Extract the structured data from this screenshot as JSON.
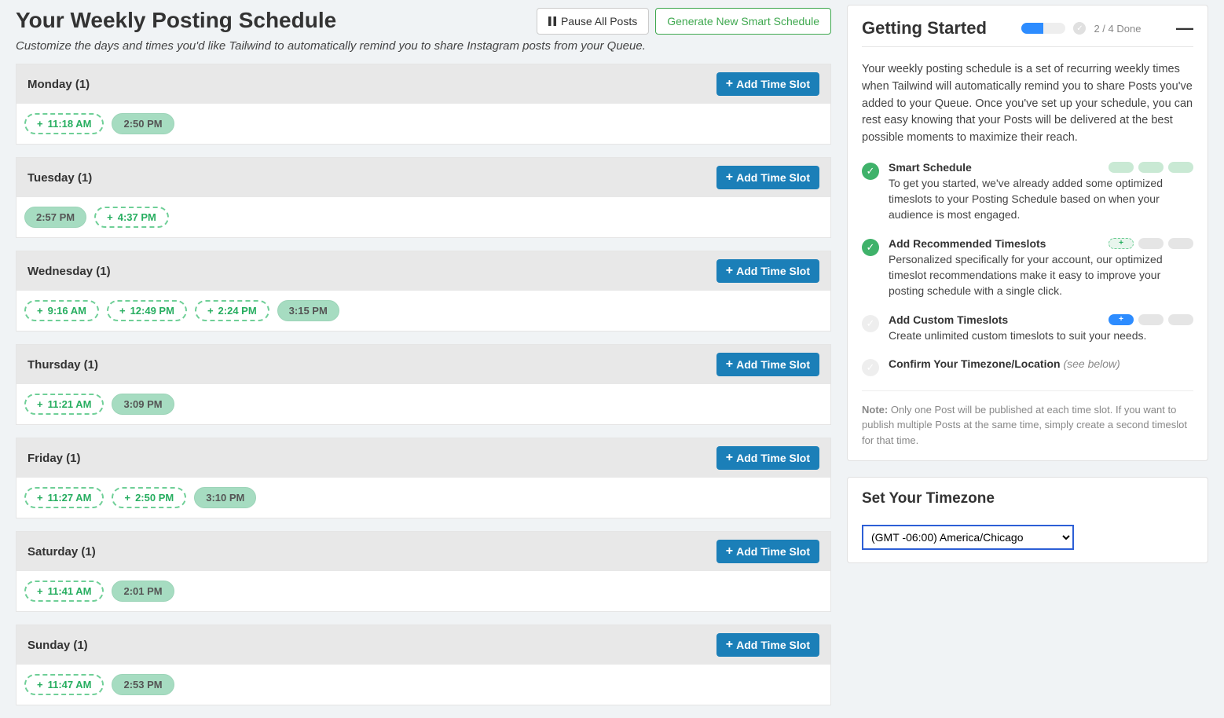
{
  "header": {
    "title": "Your Weekly Posting Schedule",
    "subtitle": "Customize the days and times you'd like Tailwind to automatically remind you to share Instagram posts from your Queue.",
    "pause_label": "Pause All Posts",
    "generate_label": "Generate New Smart Schedule"
  },
  "add_slot_label": "Add Time Slot",
  "days": [
    {
      "name": "Monday (1)",
      "slots": [
        {
          "time": "11:18 AM",
          "type": "suggested"
        },
        {
          "time": "2:50 PM",
          "type": "active"
        }
      ]
    },
    {
      "name": "Tuesday (1)",
      "slots": [
        {
          "time": "2:57 PM",
          "type": "active"
        },
        {
          "time": "4:37 PM",
          "type": "suggested"
        }
      ]
    },
    {
      "name": "Wednesday (1)",
      "slots": [
        {
          "time": "9:16 AM",
          "type": "suggested"
        },
        {
          "time": "12:49 PM",
          "type": "suggested"
        },
        {
          "time": "2:24 PM",
          "type": "suggested"
        },
        {
          "time": "3:15 PM",
          "type": "active"
        }
      ]
    },
    {
      "name": "Thursday (1)",
      "slots": [
        {
          "time": "11:21 AM",
          "type": "suggested"
        },
        {
          "time": "3:09 PM",
          "type": "active"
        }
      ]
    },
    {
      "name": "Friday (1)",
      "slots": [
        {
          "time": "11:27 AM",
          "type": "suggested"
        },
        {
          "time": "2:50 PM",
          "type": "suggested"
        },
        {
          "time": "3:10 PM",
          "type": "active"
        }
      ]
    },
    {
      "name": "Saturday (1)",
      "slots": [
        {
          "time": "11:41 AM",
          "type": "suggested"
        },
        {
          "time": "2:01 PM",
          "type": "active"
        }
      ]
    },
    {
      "name": "Sunday (1)",
      "slots": [
        {
          "time": "11:47 AM",
          "type": "suggested"
        },
        {
          "time": "2:53 PM",
          "type": "active"
        }
      ]
    }
  ],
  "getting_started": {
    "title": "Getting Started",
    "progress_percent": 50,
    "done_text": "2 / 4 Done",
    "description": "Your weekly posting schedule is a set of recurring weekly times when Tailwind will automatically remind you to share Posts you've added to your Queue. Once you've set up your schedule, you can rest easy knowing that your Posts will be delivered at the best possible moments to maximize their reach.",
    "items": [
      {
        "done": true,
        "title": "Smart Schedule",
        "desc": "To get you started, we've already added some optimized timeslots to your Posting Schedule based on when your audience is most engaged.",
        "pills": [
          "green",
          "green",
          "green"
        ]
      },
      {
        "done": true,
        "title": "Add Recommended Timeslots",
        "desc": "Personalized specifically for your account, our optimized timeslot recommendations make it easy to improve your posting schedule with a single click.",
        "pills": [
          "greenplus",
          "grey",
          "grey"
        ]
      },
      {
        "done": false,
        "title": "Add Custom Timeslots",
        "desc": "Create unlimited custom timeslots to suit your needs.",
        "pills": [
          "blue",
          "grey",
          "grey"
        ]
      },
      {
        "done": false,
        "title": "Confirm Your Timezone/Location",
        "see_below": "(see below)",
        "desc": "",
        "pills": []
      }
    ],
    "note_label": "Note:",
    "note": " Only one Post will be published at each time slot. If you want to publish multiple Posts at the same time, simply create a second timeslot for that time."
  },
  "timezone": {
    "title": "Set Your Timezone",
    "selected": "(GMT -06:00) America/Chicago"
  }
}
